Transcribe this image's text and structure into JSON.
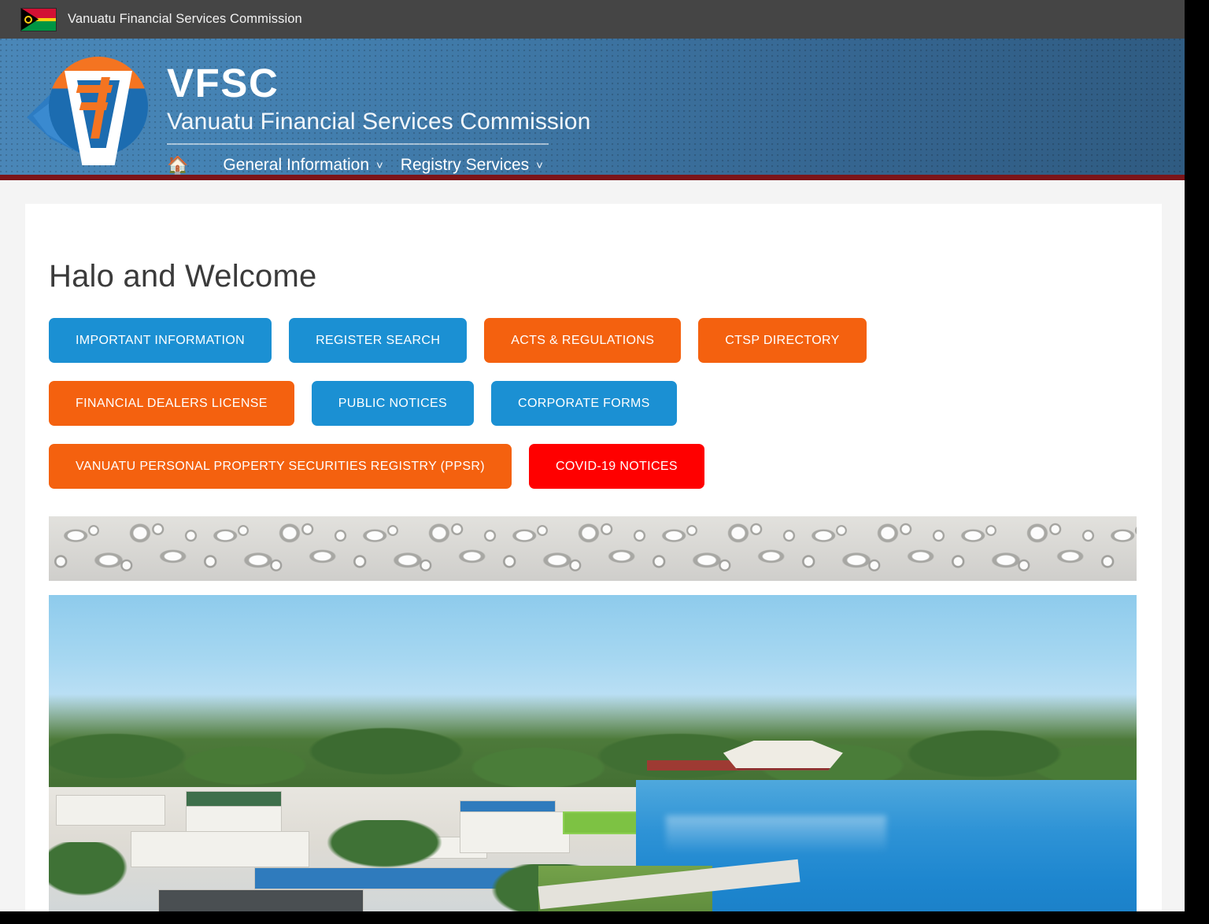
{
  "topbar": {
    "flag_icon": "vanuatu-flag-icon",
    "site_name": "Vanuatu Financial Services Commission"
  },
  "header": {
    "logo_icon": "vfsc-emblem-icon",
    "acronym": "VFSC",
    "full_name": "Vanuatu Financial Services Commission",
    "nav": {
      "home_icon": "home-icon",
      "items": [
        {
          "label": "General Information",
          "caret": "˅"
        },
        {
          "label": "Registry Services",
          "caret": "˅"
        }
      ]
    }
  },
  "main": {
    "heading": "Halo and Welcome",
    "button_rows": [
      [
        {
          "label": "IMPORTANT INFORMATION",
          "color": "blue"
        },
        {
          "label": "REGISTER SEARCH",
          "color": "blue"
        },
        {
          "label": "ACTS & REGULATIONS",
          "color": "orange"
        },
        {
          "label": "CTSP DIRECTORY",
          "color": "orange"
        }
      ],
      [
        {
          "label": "FINANCIAL DEALERS LICENSE",
          "color": "orange"
        },
        {
          "label": "PUBLIC NOTICES",
          "color": "blue"
        },
        {
          "label": "CORPORATE FORMS",
          "color": "blue"
        }
      ],
      [
        {
          "label": "VANUATU PERSONAL PROPERTY SECURITIES REGISTRY (PPSR)",
          "color": "orange"
        },
        {
          "label": "COVID-19 NOTICES",
          "color": "red"
        }
      ]
    ],
    "divider_image": "carved-relief-pattern-band",
    "hero_image": "port-vila-harbour-aerial-photo"
  },
  "colors": {
    "blue": "#1b90d3",
    "orange": "#f4610f",
    "red": "#ff0000",
    "header_blue": "#3e76a4",
    "header_accent_red": "#7b1419",
    "topbar_gray": "#454545",
    "page_background": "#f4f4f4"
  }
}
